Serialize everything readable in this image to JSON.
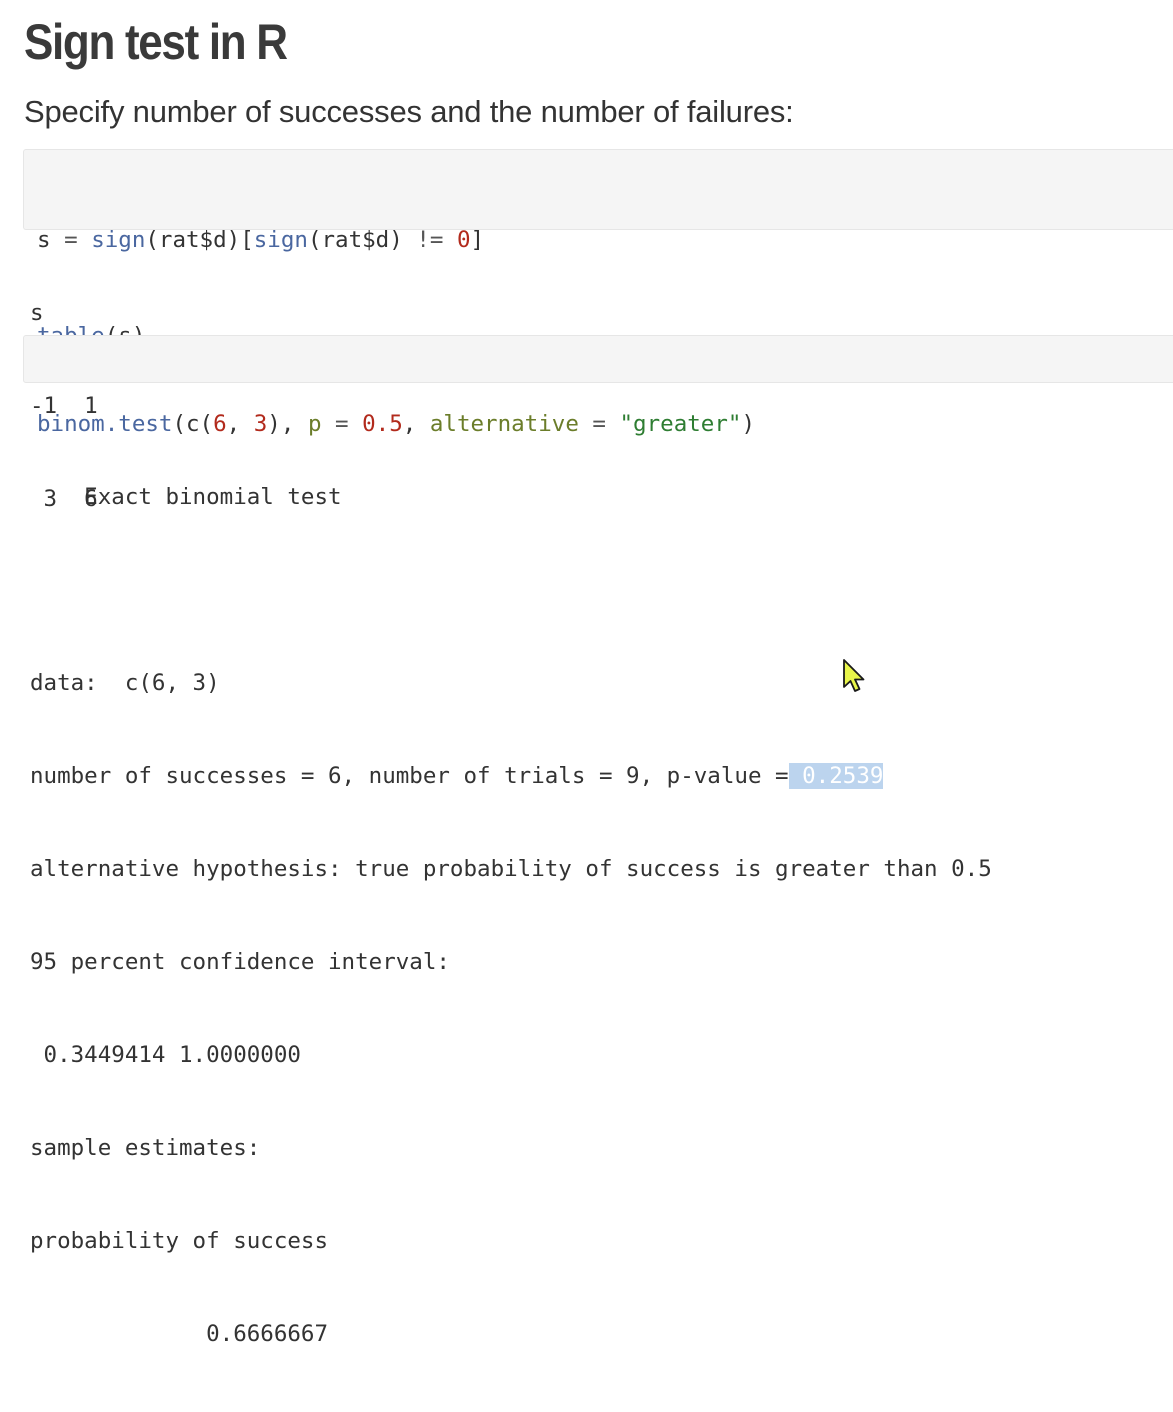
{
  "slide": {
    "title": "Sign test in R",
    "subtitle": "Specify number of successes and the number of failures:"
  },
  "code1": {
    "line1": {
      "var": "s",
      "assign": " = ",
      "fn1": "sign",
      "p1": "(rat$d)[",
      "fn2": "sign",
      "p2": "(rat$d) ",
      "neq": "!=",
      "sp": " ",
      "zero": "0",
      "close": "]"
    },
    "line2": {
      "fn": "table",
      "rest": "(s)"
    }
  },
  "output1": {
    "lines": [
      "s",
      "-1  1",
      " 3  6"
    ]
  },
  "code2": {
    "fn": "binom.test",
    "open": "(c(",
    "n1": "6",
    "comma1": ", ",
    "n2": "3",
    "comma2": "), ",
    "arg_p": "p",
    "eq1": " = ",
    "n3": "0.5",
    "comma3": ", ",
    "arg_alt": "alternative",
    "eq2": " = ",
    "str": "\"greater\"",
    "close": ")"
  },
  "output2": {
    "heading": "    Exact binomial test",
    "blank": "",
    "data_line": "data:  c(6, 3)",
    "successes_prefix": "number of successes = 6, number of trials = 9, p-value =",
    "pvalue": " 0.2539",
    "alt_hyp": "alternative hypothesis: true probability of success is greater than 0.5",
    "ci_label": "95 percent confidence interval:",
    "ci_values": " 0.3449414 1.0000000",
    "estimates_label": "sample estimates:",
    "estimate_name": "probability of success",
    "estimate_value": "             0.6666667"
  },
  "colors": {
    "function": "#4a67a0",
    "number": "#b22a1c",
    "string": "#2e7d32",
    "argument": "#6b7d2a",
    "highlight": "#bcd4ee",
    "code_background": "#f5f5f5"
  },
  "icons": {
    "cursor": "mouse-pointer-icon"
  }
}
